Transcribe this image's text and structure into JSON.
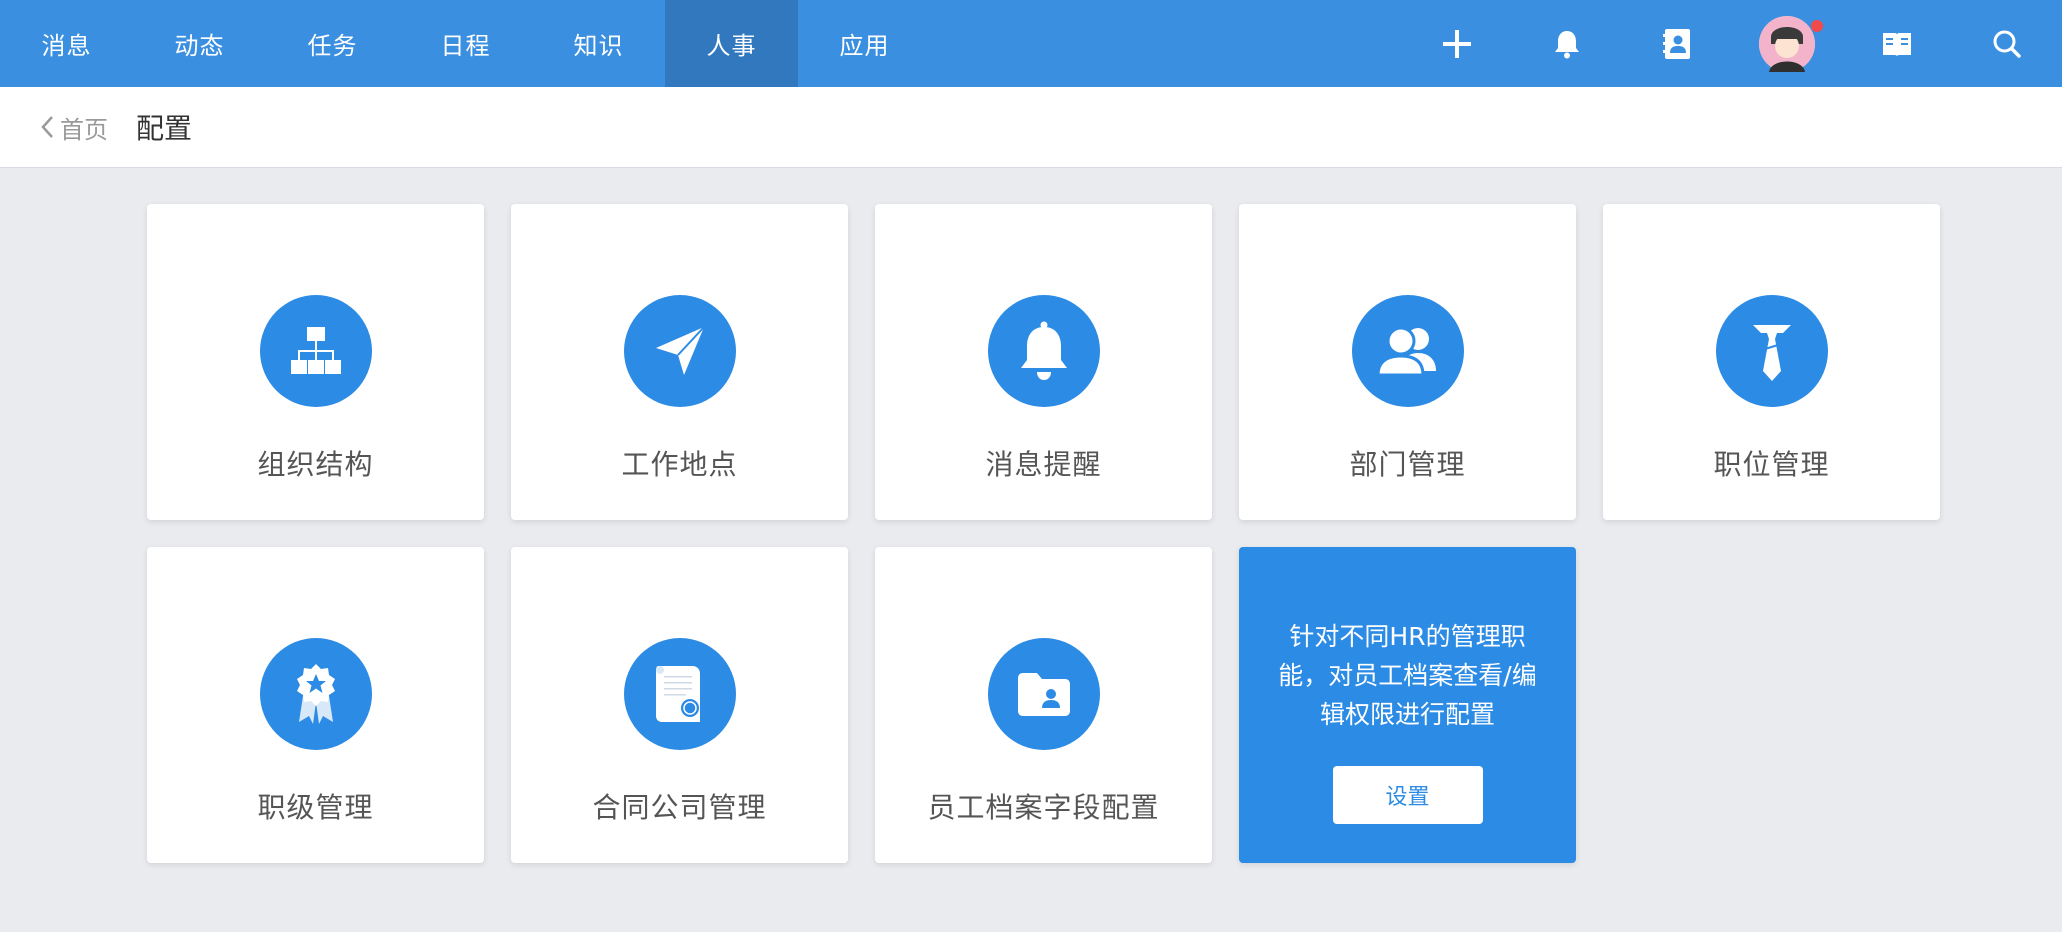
{
  "nav": {
    "items": [
      {
        "label": "消息"
      },
      {
        "label": "动态"
      },
      {
        "label": "任务"
      },
      {
        "label": "日程"
      },
      {
        "label": "知识"
      },
      {
        "label": "人事",
        "active": true
      },
      {
        "label": "应用"
      }
    ],
    "tools": [
      "plus-icon",
      "bell-icon",
      "contacts-icon",
      "avatar",
      "book-icon",
      "search-icon"
    ],
    "accent": "#3b8fe0",
    "active_bg": "#3278bf"
  },
  "breadcrumb": {
    "back_label": "首页",
    "title": "配置"
  },
  "cards": [
    {
      "label": "组织结构",
      "icon": "org-chart-icon"
    },
    {
      "label": "工作地点",
      "icon": "send-arrow-icon"
    },
    {
      "label": "消息提醒",
      "icon": "bell-icon"
    },
    {
      "label": "部门管理",
      "icon": "users-icon"
    },
    {
      "label": "职位管理",
      "icon": "tie-icon"
    },
    {
      "label": "职级管理",
      "icon": "badge-star-icon"
    },
    {
      "label": "合同公司管理",
      "icon": "certificate-icon"
    },
    {
      "label": "员工档案字段配置",
      "icon": "folder-user-icon"
    }
  ],
  "promo": {
    "text": "针对不同HR的管理职能，对员工档案查看/编辑权限进行配置",
    "button_label": "设置",
    "color": "#2c8be4"
  }
}
